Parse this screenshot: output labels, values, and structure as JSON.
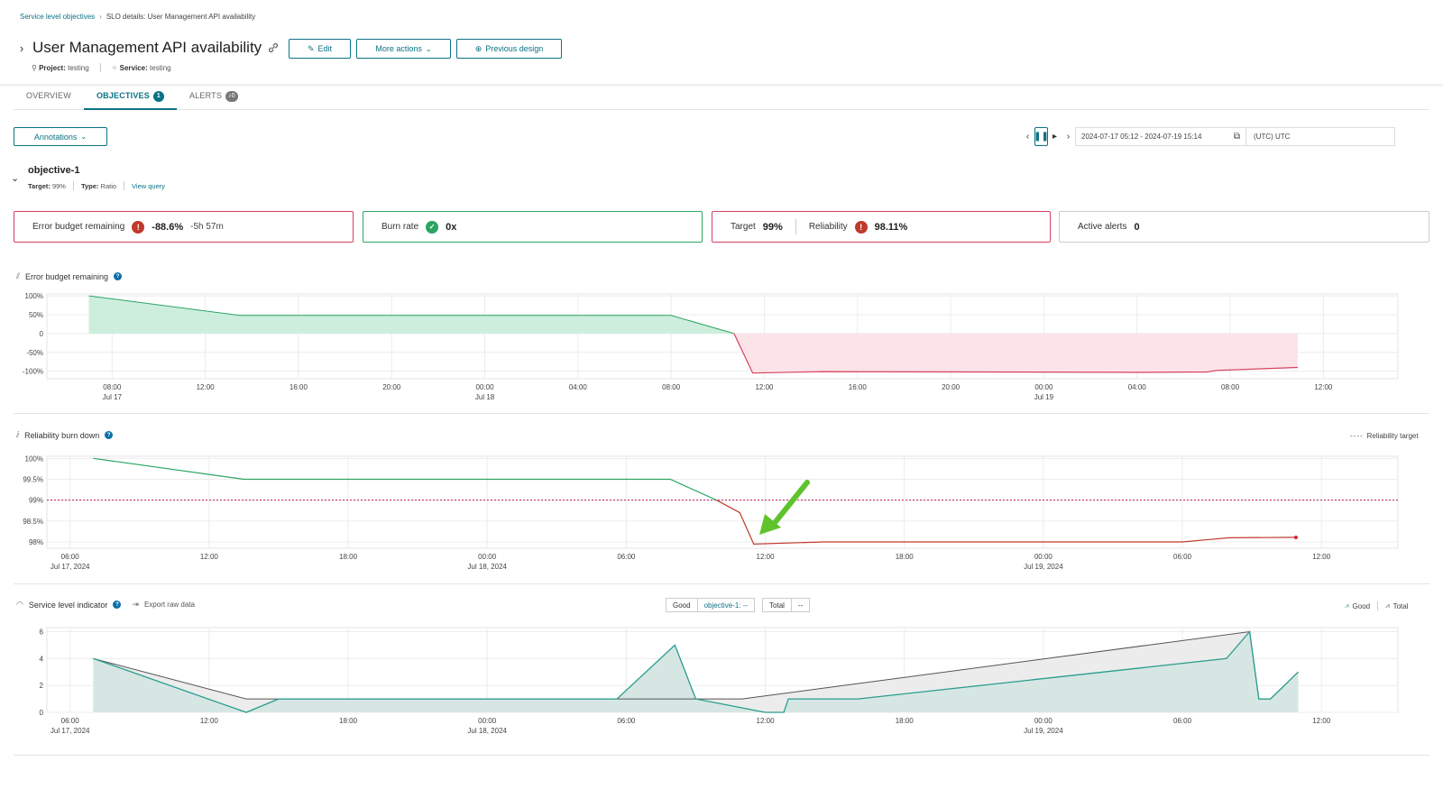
{
  "breadcrumb": {
    "root": "Service level objectives",
    "current": "SLO details: User Management API availability"
  },
  "header": {
    "title": "User Management API availability",
    "edit_label": "Edit",
    "more_actions_label": "More actions",
    "previous_design_label": "Previous design",
    "project_key": "Project:",
    "project_value": "testing",
    "service_key": "Service:",
    "service_value": "testing"
  },
  "tabs": [
    {
      "label": "OVERVIEW",
      "badge": ""
    },
    {
      "label": "OBJECTIVES",
      "badge": "1"
    },
    {
      "label": "ALERTS",
      "badge": "0"
    }
  ],
  "toolbar": {
    "annotations_label": "Annotations",
    "time_range": "2024-07-17 05:12 - 2024-07-19 15:14",
    "timezone": "(UTC) UTC"
  },
  "objective": {
    "name": "objective-1",
    "target_key": "Target:",
    "target_value": "99%",
    "type_key": "Type:",
    "type_value": "Ratio",
    "view_query_label": "View query"
  },
  "cards": {
    "error_budget_label": "Error budget remaining",
    "error_budget_value": "-88.6%",
    "error_budget_time": "-5h 57m",
    "burn_rate_label": "Burn rate",
    "burn_rate_value": "0x",
    "target_label": "Target",
    "target_value": "99%",
    "reliability_label": "Reliability",
    "reliability_value": "98.11%",
    "active_alerts_label": "Active alerts",
    "active_alerts_value": "0"
  },
  "sections": {
    "error_budget_title": "Error budget remaining",
    "burn_down_title": "Reliability burn down",
    "burn_down_legend": "Reliability target",
    "sli_title": "Service level indicator",
    "export_label": "Export raw data",
    "good_label": "Good",
    "good_select": "objective-1: --",
    "total_label": "Total",
    "total_select": "--",
    "legend_good": "Good",
    "legend_total": "Total"
  },
  "colors": {
    "accent": "#0b7285",
    "healthy": "#2aa561",
    "breach": "#d64060",
    "sli": "#2a9d8f"
  },
  "chart_data": [
    {
      "type": "area",
      "title": "Error budget remaining",
      "y_ticks": [
        "100%",
        "50%",
        "0",
        "-50%",
        "-100%"
      ],
      "x_ticks": [
        {
          "time": "08:00",
          "date": "Jul 17"
        },
        {
          "time": "12:00",
          "date": ""
        },
        {
          "time": "16:00",
          "date": ""
        },
        {
          "time": "20:00",
          "date": ""
        },
        {
          "time": "00:00",
          "date": "Jul 18"
        },
        {
          "time": "04:00",
          "date": ""
        },
        {
          "time": "08:00",
          "date": ""
        },
        {
          "time": "12:00",
          "date": ""
        },
        {
          "time": "16:00",
          "date": ""
        },
        {
          "time": "20:00",
          "date": ""
        },
        {
          "time": "00:00",
          "date": "Jul 19"
        },
        {
          "time": "04:00",
          "date": ""
        },
        {
          "time": "08:00",
          "date": ""
        },
        {
          "time": "12:00",
          "date": ""
        }
      ],
      "x_hours_start": 5.2,
      "x_hours_end": 63.2,
      "ylim": [
        -120,
        105
      ],
      "points": [
        [
          7,
          100
        ],
        [
          13.5,
          48
        ],
        [
          32,
          48
        ],
        [
          34.7,
          0
        ],
        [
          35.5,
          -105
        ],
        [
          38.5,
          -101
        ],
        [
          52,
          -103
        ],
        [
          55,
          -102
        ],
        [
          55.4,
          -98
        ],
        [
          58.9,
          -90
        ]
      ]
    },
    {
      "type": "line",
      "title": "Reliability burn down",
      "y_ticks": [
        "100%",
        "99.5%",
        "99%",
        "98.5%",
        "98%"
      ],
      "x_ticks": [
        {
          "time": "06:00",
          "date": "Jul 17, 2024"
        },
        {
          "time": "12:00",
          "date": ""
        },
        {
          "time": "18:00",
          "date": ""
        },
        {
          "time": "00:00",
          "date": "Jul 18, 2024"
        },
        {
          "time": "06:00",
          "date": ""
        },
        {
          "time": "12:00",
          "date": ""
        },
        {
          "time": "18:00",
          "date": ""
        },
        {
          "time": "00:00",
          "date": "Jul 19, 2024"
        },
        {
          "time": "06:00",
          "date": ""
        },
        {
          "time": "12:00",
          "date": ""
        }
      ],
      "x_hours_start": 5,
      "x_hours_end": 63.3,
      "ylim": [
        97.85,
        100.05
      ],
      "target": 99,
      "points": [
        [
          7,
          100
        ],
        [
          13.5,
          99.5
        ],
        [
          31.9,
          99.5
        ],
        [
          33.9,
          99.0
        ],
        [
          34.9,
          98.7
        ],
        [
          35.5,
          97.95
        ],
        [
          38.5,
          98.0
        ],
        [
          54,
          98.0
        ],
        [
          55,
          98.05
        ],
        [
          56,
          98.1
        ],
        [
          58.9,
          98.11
        ]
      ]
    },
    {
      "type": "area",
      "title": "Service level indicator",
      "y_ticks": [
        "6",
        "4",
        "2",
        "0"
      ],
      "x_ticks": [
        {
          "time": "06:00",
          "date": "Jul 17, 2024"
        },
        {
          "time": "12:00",
          "date": ""
        },
        {
          "time": "18:00",
          "date": ""
        },
        {
          "time": "00:00",
          "date": "Jul 18, 2024"
        },
        {
          "time": "06:00",
          "date": ""
        },
        {
          "time": "12:00",
          "date": ""
        },
        {
          "time": "18:00",
          "date": ""
        },
        {
          "time": "00:00",
          "date": "Jul 19, 2024"
        },
        {
          "time": "06:00",
          "date": ""
        },
        {
          "time": "12:00",
          "date": ""
        }
      ],
      "x_hours_start": 5,
      "x_hours_end": 63.3,
      "ylim": [
        0,
        6.3
      ],
      "series": [
        {
          "name": "Total",
          "points": [
            [
              7,
              4
            ],
            [
              13.6,
              1
            ],
            [
              32,
              1
            ],
            [
              35,
              1
            ],
            [
              56.9,
              6
            ],
            [
              57.3,
              1
            ],
            [
              57.8,
              1
            ],
            [
              59,
              3
            ]
          ]
        },
        {
          "name": "Good",
          "points": [
            [
              7,
              4
            ],
            [
              13.6,
              0
            ],
            [
              15,
              1
            ],
            [
              29.6,
              1
            ],
            [
              32.1,
              5
            ],
            [
              33,
              1
            ],
            [
              36,
              0
            ],
            [
              36.8,
              0
            ],
            [
              37,
              1
            ],
            [
              40,
              1
            ],
            [
              55.9,
              4
            ],
            [
              56.9,
              6
            ],
            [
              57.3,
              1
            ],
            [
              57.8,
              1
            ],
            [
              59,
              3
            ]
          ]
        }
      ]
    }
  ]
}
